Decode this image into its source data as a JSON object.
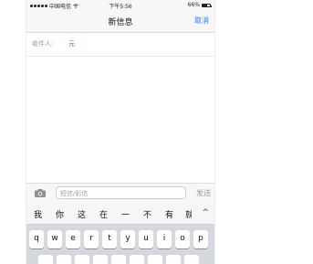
{
  "status_bar": {
    "carrier": "中国电信",
    "time": "下午5:56",
    "battery": "66%",
    "battery_level": 0.66
  },
  "nav": {
    "title": "新信息",
    "cancel_label": "取消"
  },
  "recipient": {
    "label": "收件人:",
    "value": "元"
  },
  "compose": {
    "placeholder": "短信/彩信",
    "send_label": "发送"
  },
  "keyboard": {
    "candidates": [
      "我",
      "你",
      "这",
      "在",
      "一",
      "不",
      "有",
      "就"
    ],
    "expand_label": "^",
    "row1": [
      "q",
      "w",
      "e",
      "r",
      "t",
      "y",
      "u",
      "i",
      "o",
      "p"
    ]
  }
}
